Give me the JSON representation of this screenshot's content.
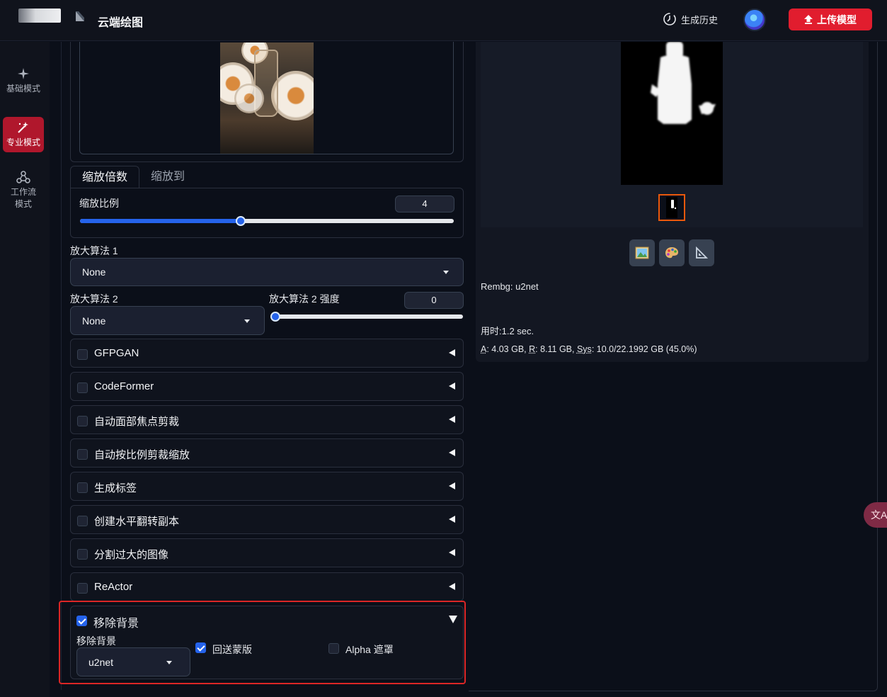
{
  "header": {
    "title": "云端绘图",
    "history_label": "生成历史",
    "upload_label": "上传模型"
  },
  "sidebar": {
    "items": [
      {
        "label": "基础模式",
        "icon": "sparkle-icon"
      },
      {
        "label": "专业模式",
        "icon": "magic-wand-icon"
      },
      {
        "label_line1": "工作流",
        "label_line2": "模式",
        "icon": "workflow-icon"
      }
    ]
  },
  "scale": {
    "tabs": [
      "缩放倍数",
      "缩放到"
    ],
    "ratio_label": "缩放比例",
    "ratio_value": "4",
    "ratio_fraction": 0.43
  },
  "upscaler1": {
    "label": "放大算法 1",
    "value": "None"
  },
  "upscaler2": {
    "label": "放大算法 2",
    "value": "None",
    "strength_label": "放大算法 2 强度",
    "strength_value": "0",
    "strength_fraction": 0
  },
  "accordions": [
    "GFPGAN",
    "CodeFormer",
    "自动面部焦点剪裁",
    "自动按比例剪裁缩放",
    "生成标签",
    "创建水平翻转副本",
    "分割过大的图像",
    "ReActor"
  ],
  "remove_bg": {
    "title": "移除背景",
    "checked": true,
    "model_label": "移除背景",
    "model_value": "u2net",
    "return_mask_label": "回送蒙版",
    "return_mask_checked": true,
    "alpha_label": "Alpha 遮罩",
    "alpha_checked": false
  },
  "result": {
    "rembg_text": "Rembg: u2net",
    "time_text": "用时:1.2 sec.",
    "vram": {
      "a_key": "A",
      "a_val": ": 4.03 GB, ",
      "r_key": "R",
      "r_val": ": 8.11 GB, ",
      "sys_key": "Sys",
      "sys_val": ": 10.0/22.1992 GB (45.0%)"
    },
    "tool_icons": [
      "image-icon",
      "palette-icon",
      "ruler-triangle-icon"
    ]
  },
  "translate_label": "文A",
  "colors": {
    "accent_blue": "#2563eb",
    "brand_red": "#e11d2e",
    "highlight_red": "#dc2626",
    "selected_thumb": "#ea580c"
  }
}
